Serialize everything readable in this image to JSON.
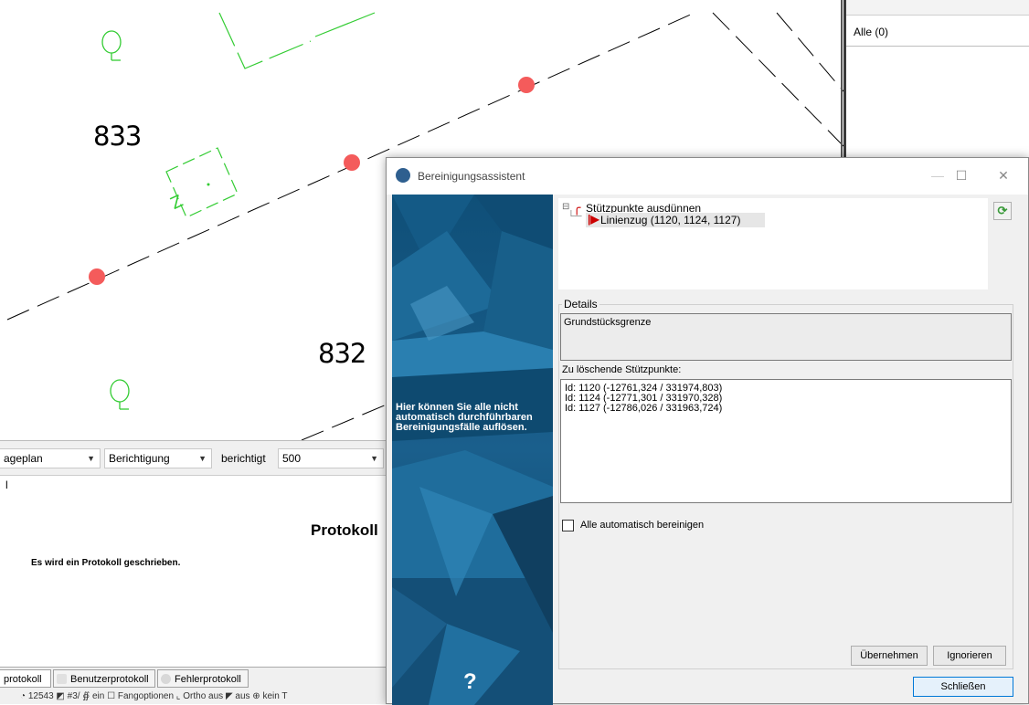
{
  "cad": {
    "parcel_numbers": [
      "833",
      "832"
    ]
  },
  "right_panel": {
    "filter_label": "Alle (0)"
  },
  "toolbar": {
    "combo1_value": "ageplan",
    "combo2_value": "Berichtigung",
    "label_berichtigt": "berichtigt",
    "combo3_value": "500",
    "row2_text": "l"
  },
  "protokoll": {
    "title": "Protokoll",
    "message": "Es wird ein Protokoll geschrieben."
  },
  "tabs": [
    {
      "label": "protokoll"
    },
    {
      "label": "Benutzerprotokoll"
    },
    {
      "label": "Fehlerprotokoll"
    }
  ],
  "statusbar": {
    "text": "◔ 12543  ◩ #3/  ∯ ein  ☐ Fangoptionen  ⌞ Ortho aus  ◤ aus  ⊕ kein T"
  },
  "dialog": {
    "title": "Bereinigungsassistent",
    "side_text": "Hier können Sie alle nicht automatisch durchführbaren Bereinigungsfälle auflösen.",
    "help_symbol": "?",
    "tree": {
      "root_label": "Stützpunkte ausdünnen",
      "child_label": "Linienzug (1120, 1124, 1127)"
    },
    "details_label": "Details",
    "details_value": "Grundstücksgrenze",
    "points_label": "Zu löschende Stützpunkte:",
    "points": [
      "Id: 1120 (-12761,324 / 331974,803)",
      "Id: 1124 (-12771,301 / 331970,328)",
      "Id: 1127 (-12786,026 / 331963,724)"
    ],
    "auto_checkbox_label": "Alle automatisch bereinigen",
    "auto_checked": false,
    "buttons": {
      "apply": "Übernehmen",
      "ignore": "Ignorieren",
      "close": "Schließen"
    }
  }
}
